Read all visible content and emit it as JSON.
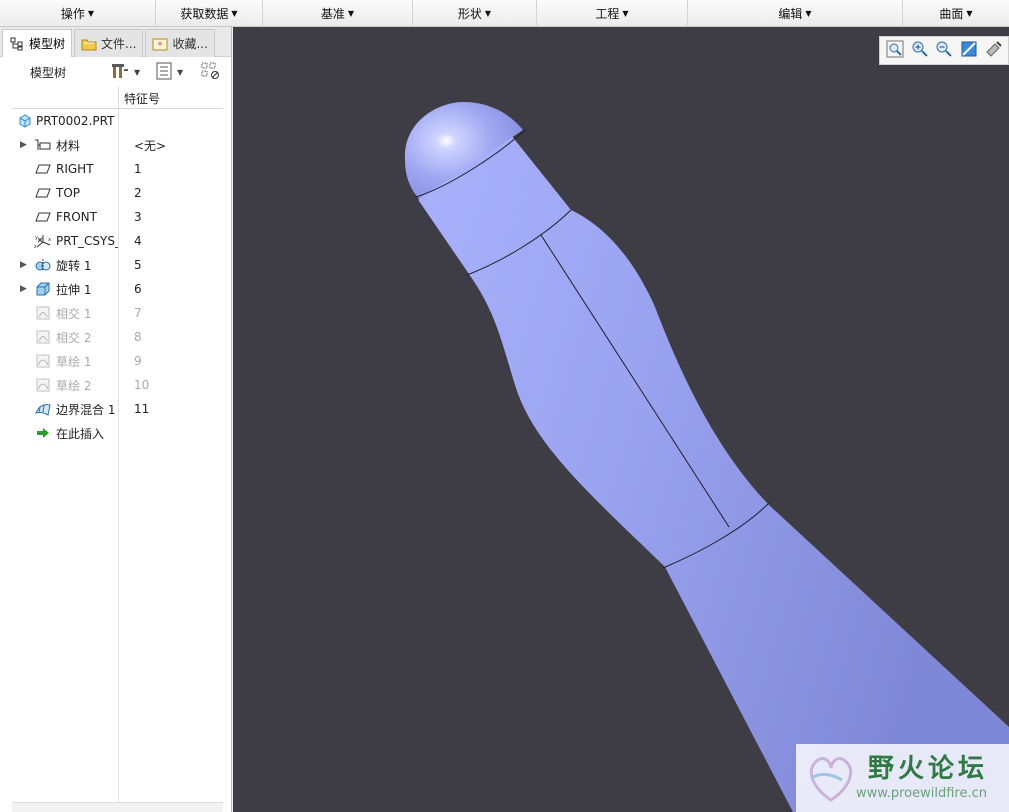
{
  "menubar": {
    "items": [
      {
        "label": "操作"
      },
      {
        "label": "获取数据"
      },
      {
        "label": "基准"
      },
      {
        "label": "形状"
      },
      {
        "label": "工程"
      },
      {
        "label": "编辑"
      },
      {
        "label": "曲面"
      }
    ]
  },
  "left_panel": {
    "tabs": [
      {
        "label": "模型树",
        "icon": "tree-icon",
        "active": true
      },
      {
        "label": "文件...",
        "icon": "folder-icon",
        "active": false
      },
      {
        "label": "收藏...",
        "icon": "favorites-icon",
        "active": false
      }
    ],
    "toolbar": {
      "title": "模型树",
      "settings_icon": "tree-settings-icon",
      "columns_icon": "tree-columns-icon",
      "filter_icon": "tree-filter-icon"
    },
    "column_header": "特征号",
    "tree": {
      "root": "PRT0002.PRT",
      "rows": [
        {
          "label": "材料",
          "num": "<无>",
          "icon": "material-icon",
          "expandable": true,
          "dim": false
        },
        {
          "label": "RIGHT",
          "num": "1",
          "icon": "datum-plane-icon",
          "expandable": false,
          "dim": false
        },
        {
          "label": "TOP",
          "num": "2",
          "icon": "datum-plane-icon",
          "expandable": false,
          "dim": false
        },
        {
          "label": "FRONT",
          "num": "3",
          "icon": "datum-plane-icon",
          "expandable": false,
          "dim": false
        },
        {
          "label": "PRT_CSYS_",
          "num": "4",
          "icon": "csys-icon",
          "expandable": false,
          "dim": false
        },
        {
          "label": "旋转 1",
          "num": "5",
          "icon": "revolve-icon",
          "expandable": true,
          "dim": false
        },
        {
          "label": "拉伸 1",
          "num": "6",
          "icon": "extrude-icon",
          "expandable": true,
          "dim": false
        },
        {
          "label": "相交 1",
          "num": "7",
          "icon": "intersect-icon",
          "expandable": false,
          "dim": true
        },
        {
          "label": "相交 2",
          "num": "8",
          "icon": "intersect-icon",
          "expandable": false,
          "dim": true
        },
        {
          "label": "草绘 1",
          "num": "9",
          "icon": "sketch-icon",
          "expandable": false,
          "dim": true
        },
        {
          "label": "草绘 2",
          "num": "10",
          "icon": "sketch-icon",
          "expandable": false,
          "dim": true
        },
        {
          "label": "边界混合 1",
          "num": "11",
          "icon": "boundary-blend-icon",
          "expandable": false,
          "dim": false
        },
        {
          "label": "在此插入",
          "num": "",
          "icon": "insert-here-icon",
          "expandable": false,
          "dim": false
        }
      ]
    }
  },
  "view_toolbar": {
    "buttons": [
      "refit-icon",
      "zoom-in-icon",
      "zoom-out-icon",
      "repaint-icon",
      "display-style-icon"
    ]
  },
  "watermark": {
    "title": "野火论坛",
    "url": "www.proewildfire.cn"
  },
  "colors": {
    "viewport_bg": "#3e3d46",
    "model_surface": "#9aa3f0",
    "watermark_green": "#2f7a44"
  }
}
